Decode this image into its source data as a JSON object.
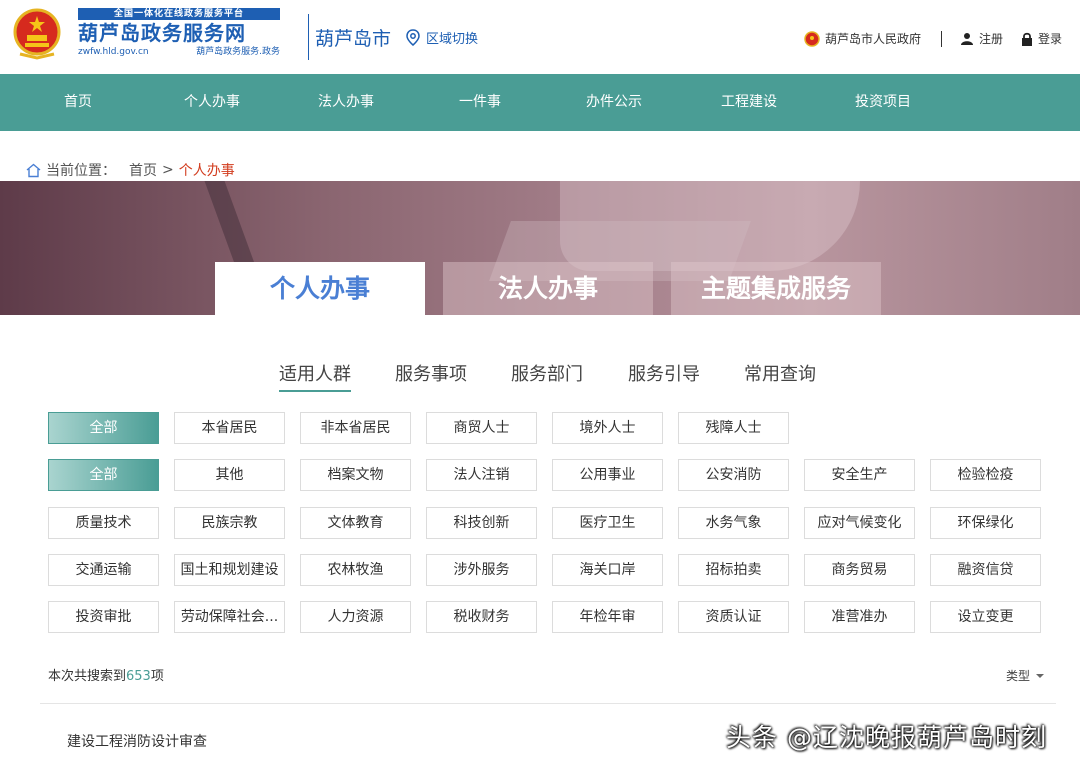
{
  "header": {
    "logo_banner": "全国一体化在线政务服务平台",
    "logo_title": "葫芦岛政务服务网",
    "logo_domain": "zwfw.hld.gov.cn",
    "logo_tagline": "葫芦岛政务服务.政务",
    "city": "葫芦岛市",
    "region_switch": "区域切换",
    "gov_link": "葫芦岛市人民政府",
    "register": "注册",
    "login": "登录"
  },
  "nav": [
    "首页",
    "个人办事",
    "法人办事",
    "一件事",
    "办件公示",
    "工程建设",
    "投资项目"
  ],
  "breadcrumb": {
    "label": "当前位置：",
    "home": "首页",
    "sep": ">",
    "current": "个人办事"
  },
  "hero_tabs": [
    "个人办事",
    "法人办事",
    "主题集成服务"
  ],
  "subtabs": [
    "适用人群",
    "服务事项",
    "服务部门",
    "服务引导",
    "常用查询"
  ],
  "row1": [
    "全部",
    "本省居民",
    "非本省居民",
    "商贸人士",
    "境外人士",
    "残障人士"
  ],
  "rows": [
    [
      "全部",
      "其他",
      "档案文物",
      "法人注销",
      "公用事业",
      "公安消防",
      "安全生产",
      "检验检疫"
    ],
    [
      "质量技术",
      "民族宗教",
      "文体教育",
      "科技创新",
      "医疗卫生",
      "水务气象",
      "应对气候变化",
      "环保绿化"
    ],
    [
      "交通运输",
      "国土和规划建设",
      "农林牧渔",
      "涉外服务",
      "海关口岸",
      "招标拍卖",
      "商务贸易",
      "融资信贷"
    ],
    [
      "投资审批",
      "劳动保障社会...",
      "人力资源",
      "税收财务",
      "年检年审",
      "资质认证",
      "准营准办",
      "设立变更"
    ]
  ],
  "result_count": {
    "prefix": "本次共搜索到",
    "num": "653",
    "suffix": "项"
  },
  "sort_label": "类型",
  "first_result": "建设工程消防设计审查",
  "watermark": "头条 @辽沈晚报葫芦岛时刻",
  "colors": {
    "primary": "#4a9d95",
    "brand_blue": "#1e5fb3",
    "active_tab": "#4a7fd4",
    "highlight": "#d23c1e"
  }
}
